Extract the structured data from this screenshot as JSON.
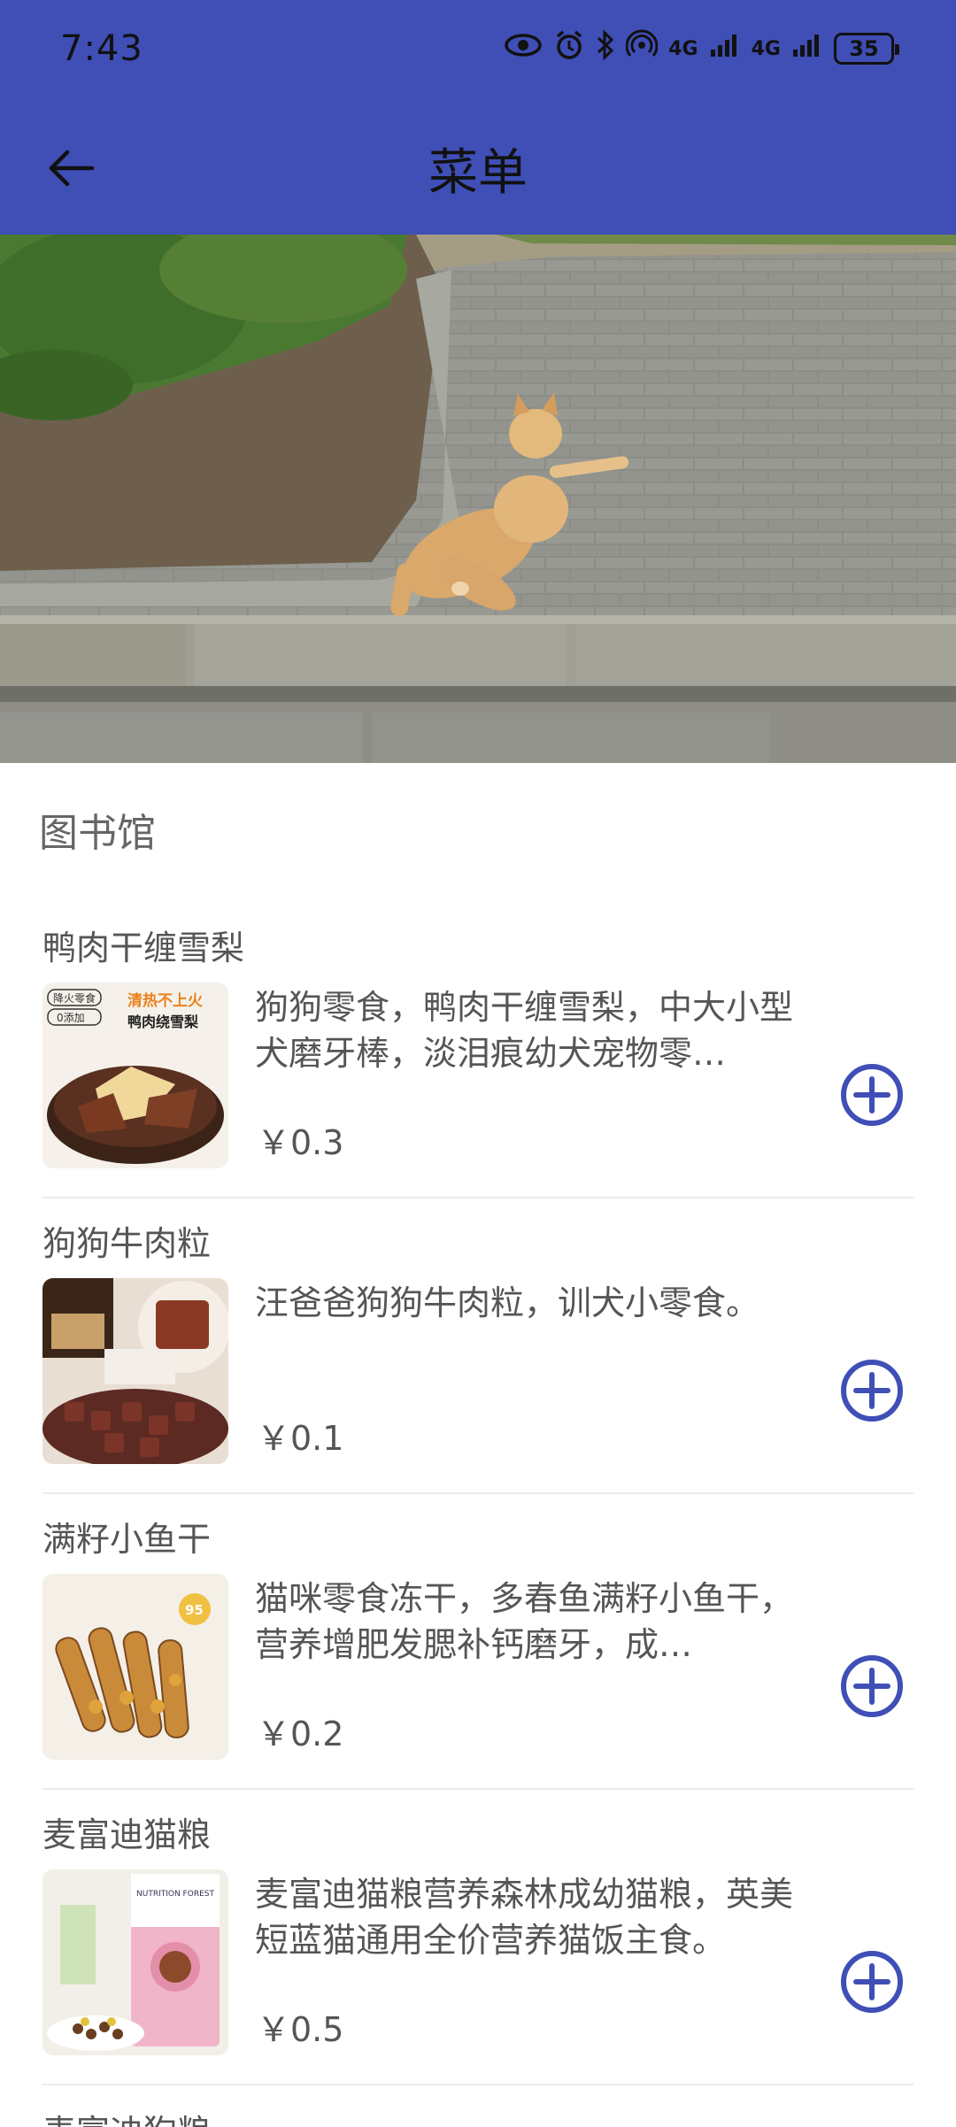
{
  "status_bar": {
    "time": "7:43",
    "signal_1": "4G",
    "signal_2": "4G",
    "battery": "35"
  },
  "header": {
    "title": "菜单"
  },
  "section": {
    "title": "图书馆"
  },
  "items": [
    {
      "name": "鸭肉干缠雪梨",
      "description": "狗狗零食，鸭肉干缠雪梨，中大小型犬磨牙棒，淡泪痕幼犬宠物零…",
      "price": "￥0.3",
      "thumb_text_1": "清热不上火",
      "thumb_text_2": "鸭肉绕雪梨",
      "thumb_text_3": "降火零食",
      "thumb_text_4": "0添加"
    },
    {
      "name": "狗狗牛肉粒",
      "description": "汪爸爸狗狗牛肉粒，训犬小零食。",
      "price": "￥0.1"
    },
    {
      "name": "满籽小鱼干",
      "description": "猫咪零食冻干，多春鱼满籽小鱼干，营养增肥发腮补钙磨牙，成…",
      "price": "￥0.2",
      "thumb_badge": "95"
    },
    {
      "name": "麦富迪猫粮",
      "description": "麦富迪猫粮营养森林成幼猫粮，英美短蓝猫通用全价营养猫饭主食。",
      "price": "￥0.5",
      "thumb_text_1": "NUTRITION FOREST"
    }
  ],
  "partial_item": {
    "name": "麦富迪狗粮"
  },
  "colors": {
    "appbar": "#3f4fb6",
    "accent_icon": "#3f4fb6"
  }
}
